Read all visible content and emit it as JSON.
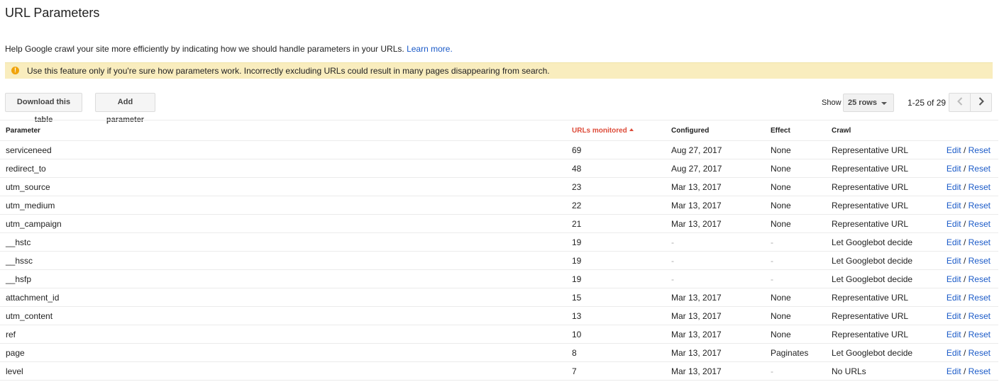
{
  "page": {
    "title": "URL Parameters",
    "intro_text": "Help Google crawl your site more efficiently by indicating how we should handle parameters in your URLs.",
    "learn_more": "Learn more."
  },
  "warning": {
    "icon": "warning-icon",
    "icon_glyph": "!",
    "text": "Use this feature only if you're sure how parameters work. Incorrectly excluding URLs could result in many pages disappearing from search."
  },
  "toolbar": {
    "download_label": "Download this table",
    "add_label": "Add parameter",
    "show_label": "Show",
    "rows_value": "25 rows",
    "range_text": "1-25 of 29"
  },
  "table": {
    "columns": {
      "parameter": "Parameter",
      "urls": "URLs monitored",
      "configured": "Configured",
      "effect": "Effect",
      "crawl": "Crawl"
    },
    "sorted_column": "urls",
    "edit_label": "Edit",
    "sep_label": "/",
    "reset_label": "Reset",
    "rows": [
      {
        "param": "serviceneed",
        "urls": "69",
        "configured": "Aug 27, 2017",
        "effect": "None",
        "crawl": "Representative URL"
      },
      {
        "param": "redirect_to",
        "urls": "48",
        "configured": "Aug 27, 2017",
        "effect": "None",
        "crawl": "Representative URL"
      },
      {
        "param": "utm_source",
        "urls": "23",
        "configured": "Mar 13, 2017",
        "effect": "None",
        "crawl": "Representative URL"
      },
      {
        "param": "utm_medium",
        "urls": "22",
        "configured": "Mar 13, 2017",
        "effect": "None",
        "crawl": "Representative URL"
      },
      {
        "param": "utm_campaign",
        "urls": "21",
        "configured": "Mar 13, 2017",
        "effect": "None",
        "crawl": "Representative URL"
      },
      {
        "param": "__hstc",
        "urls": "19",
        "configured": "-",
        "effect": "-",
        "crawl": "Let Googlebot decide"
      },
      {
        "param": "__hssc",
        "urls": "19",
        "configured": "-",
        "effect": "-",
        "crawl": "Let Googlebot decide"
      },
      {
        "param": "__hsfp",
        "urls": "19",
        "configured": "-",
        "effect": "-",
        "crawl": "Let Googlebot decide"
      },
      {
        "param": "attachment_id",
        "urls": "15",
        "configured": "Mar 13, 2017",
        "effect": "None",
        "crawl": "Representative URL"
      },
      {
        "param": "utm_content",
        "urls": "13",
        "configured": "Mar 13, 2017",
        "effect": "None",
        "crawl": "Representative URL"
      },
      {
        "param": "ref",
        "urls": "10",
        "configured": "Mar 13, 2017",
        "effect": "None",
        "crawl": "Representative URL"
      },
      {
        "param": "page",
        "urls": "8",
        "configured": "Mar 13, 2017",
        "effect": "Paginates",
        "crawl": "Let Googlebot decide"
      },
      {
        "param": "level",
        "urls": "7",
        "configured": "Mar 13, 2017",
        "effect": "-",
        "crawl": "No URLs"
      }
    ]
  }
}
